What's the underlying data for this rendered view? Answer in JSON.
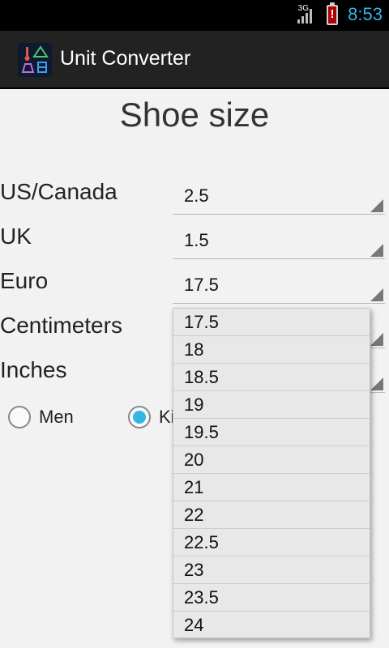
{
  "status_bar": {
    "network": "3G",
    "battery_alert": "!",
    "time": "8:53",
    "time_color": "#33b5e5"
  },
  "action_bar": {
    "title": "Unit Converter",
    "icon": "unit-converter-app-icon"
  },
  "page": {
    "title": "Shoe size"
  },
  "rows": [
    {
      "label": "US/Canada",
      "value": "2.5"
    },
    {
      "label": "UK",
      "value": "1.5"
    },
    {
      "label": "Euro",
      "value": "17.5"
    },
    {
      "label": "Centimeters",
      "value": ""
    },
    {
      "label": "Inches",
      "value": ""
    }
  ],
  "gender": {
    "options": [
      {
        "label": "Men",
        "checked": false
      },
      {
        "label": "Ki",
        "checked": true
      }
    ]
  },
  "dropdown": {
    "items": [
      "17.5",
      "18",
      "18.5",
      "19",
      "19.5",
      "20",
      "21",
      "22",
      "22.5",
      "23",
      "23.5",
      "24"
    ]
  },
  "colors": {
    "accent": "#33b5e5",
    "action_bar": "#222222",
    "background": "#f2f2f2"
  }
}
